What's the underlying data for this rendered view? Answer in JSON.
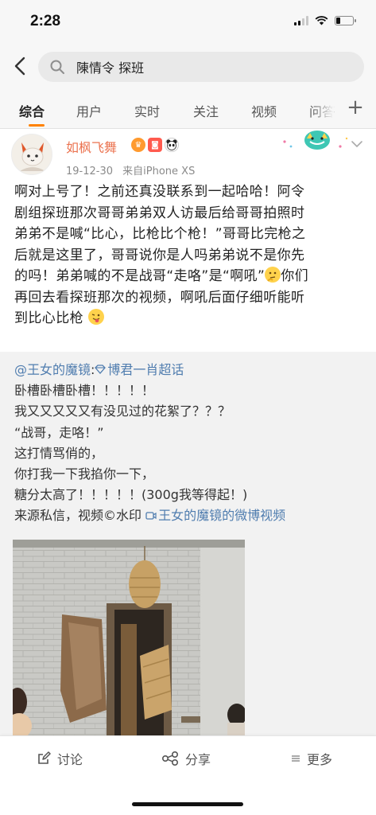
{
  "status_bar": {
    "time": "2:28"
  },
  "search": {
    "query": "陳情令 探班"
  },
  "tabs": [
    {
      "label": "综合",
      "active": true
    },
    {
      "label": "用户",
      "active": false
    },
    {
      "label": "实时",
      "active": false
    },
    {
      "label": "关注",
      "active": false
    },
    {
      "label": "视频",
      "active": false
    },
    {
      "label": "问答",
      "active": false
    }
  ],
  "post": {
    "username": "如枫飞舞",
    "date": "19-12-30",
    "source": "来自iPhone XS",
    "text_lines": [
      "啊对上号了！之前还真没联系到一起哈哈！阿令",
      "剧组探班那次哥哥弟弟双人访最后给哥哥拍照时",
      "弟弟不是喊“比心，比枪比个枪！”哥哥比完枪之",
      "后就是这里了，哥哥说你是人吗弟弟说不是你先",
      "的吗！弟弟喊的不是战哥“走咯”是“啊吼”",
      "你们",
      "再回去看探班那次的视频，啊吼后面仔细听能听",
      "到比心比枪"
    ]
  },
  "retweet": {
    "author_mention": "@王女的魔镜",
    "colon": ":",
    "topic": "博君一肖超话",
    "lines": [
      "卧槽卧槽卧槽！！！！！",
      "我又又又又又有没见过的花絮了？？？",
      "“战哥，走咯！”",
      "这打情骂俏的，",
      "你打我一下我掐你一下，",
      "糖分太高了！！！！！(300g我等得起！)"
    ],
    "source_prefix": "来源私信，视频©水印",
    "video_link": "王女的魔镜的微博视频"
  },
  "actions": {
    "comment": "讨论",
    "share": "分享",
    "more": "更多"
  },
  "colors": {
    "accent": "#ff8200",
    "username": "#eb7350",
    "link": "#507daf"
  },
  "icons": [
    "back-arrow-icon",
    "search-icon",
    "plus-icon",
    "chevron-down-icon",
    "comment-icon",
    "share-icon",
    "more-lines-icon"
  ]
}
